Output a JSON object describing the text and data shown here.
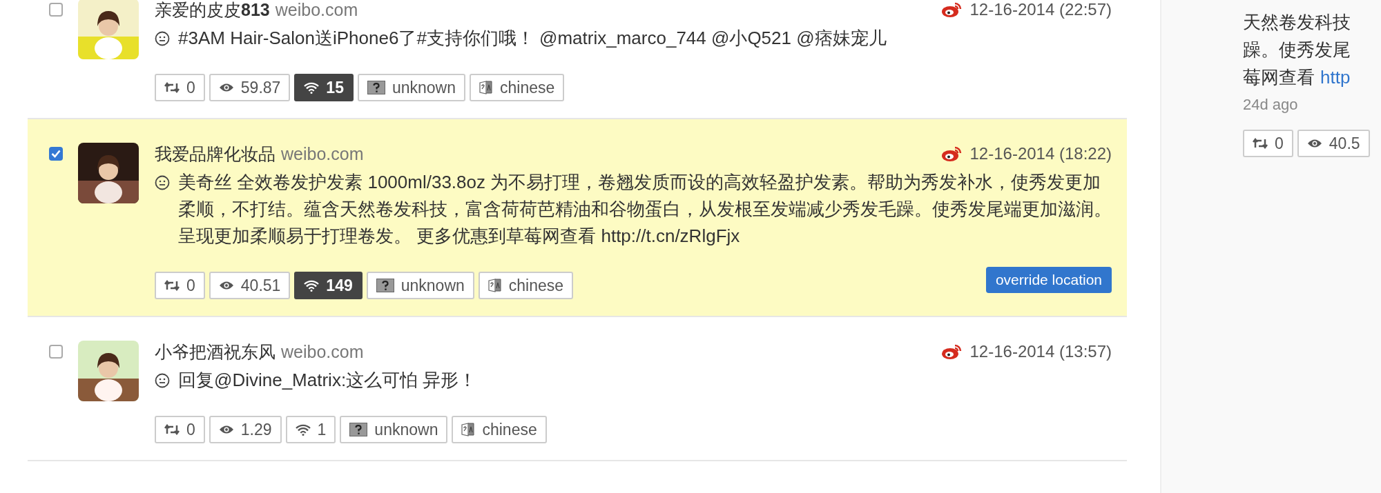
{
  "posts": [
    {
      "checked": false,
      "faded": false,
      "author": "亲爱的皮皮**813**",
      "source": "weibo.com",
      "date": "12-16-2014 (22:57)",
      "text": "#3AM Hair-Salon送iPhone6了#支持你们哦！ @matrix_marco_744 @小Q521 @痞妹宠儿",
      "badges": [
        {
          "kind": "retweets",
          "label": "0",
          "highlighted": false
        },
        {
          "kind": "views",
          "label": "59.87",
          "highlighted": false
        },
        {
          "kind": "signal",
          "label": "15",
          "highlighted": true
        },
        {
          "kind": "location",
          "label": "unknown",
          "highlighted": false
        },
        {
          "kind": "language",
          "label": "chinese",
          "highlighted": false
        }
      ]
    },
    {
      "checked": true,
      "faded": false,
      "author": "我爱品牌化妆品",
      "source": "weibo.com",
      "date": "12-16-2014 (18:22)",
      "text": "美奇丝 全效卷发护发素 1000ml/33.8oz 为不易打理，卷翘发质而设的高效轻盈护发素。帮助为秀发补水，使秀发更加柔顺，不打结。蕴含天然卷发科技，富含荷荷芭精油和谷物蛋白，从发根至发端减少秀发毛躁。使秀发尾端更加滋润。呈现更加柔顺易于打理卷发。 更多优惠到草莓网查看 http://t.cn/zRlgFjx",
      "badges": [
        {
          "kind": "retweets",
          "label": "0",
          "highlighted": false
        },
        {
          "kind": "views",
          "label": "40.51",
          "highlighted": false
        },
        {
          "kind": "signal",
          "label": "149",
          "highlighted": true
        },
        {
          "kind": "location",
          "label": "unknown",
          "highlighted": false
        },
        {
          "kind": "language",
          "label": "chinese",
          "highlighted": false
        }
      ],
      "action_button": "override location"
    },
    {
      "checked": false,
      "faded": false,
      "author": "小爷把酒祝东风",
      "source": "weibo.com",
      "date": "12-16-2014 (13:57)",
      "text": "回复@Divine_Matrix:这么可怕 异形！",
      "badges": [
        {
          "kind": "retweets",
          "label": "0",
          "highlighted": false
        },
        {
          "kind": "views",
          "label": "1.29",
          "highlighted": false
        },
        {
          "kind": "signal",
          "label": "1",
          "highlighted": false
        },
        {
          "kind": "location",
          "label": "unknown",
          "highlighted": false
        },
        {
          "kind": "language",
          "label": "chinese",
          "highlighted": false
        }
      ]
    }
  ],
  "sidebar": {
    "lines": [
      "天然卷发科技",
      "躁。使秀发尾"
    ],
    "last_line": "莓网查看",
    "link": "http",
    "time": "24d ago",
    "badges": [
      {
        "kind": "retweets",
        "label": "0",
        "highlighted": false
      },
      {
        "kind": "views",
        "label": "40.5",
        "highlighted": false
      }
    ]
  }
}
